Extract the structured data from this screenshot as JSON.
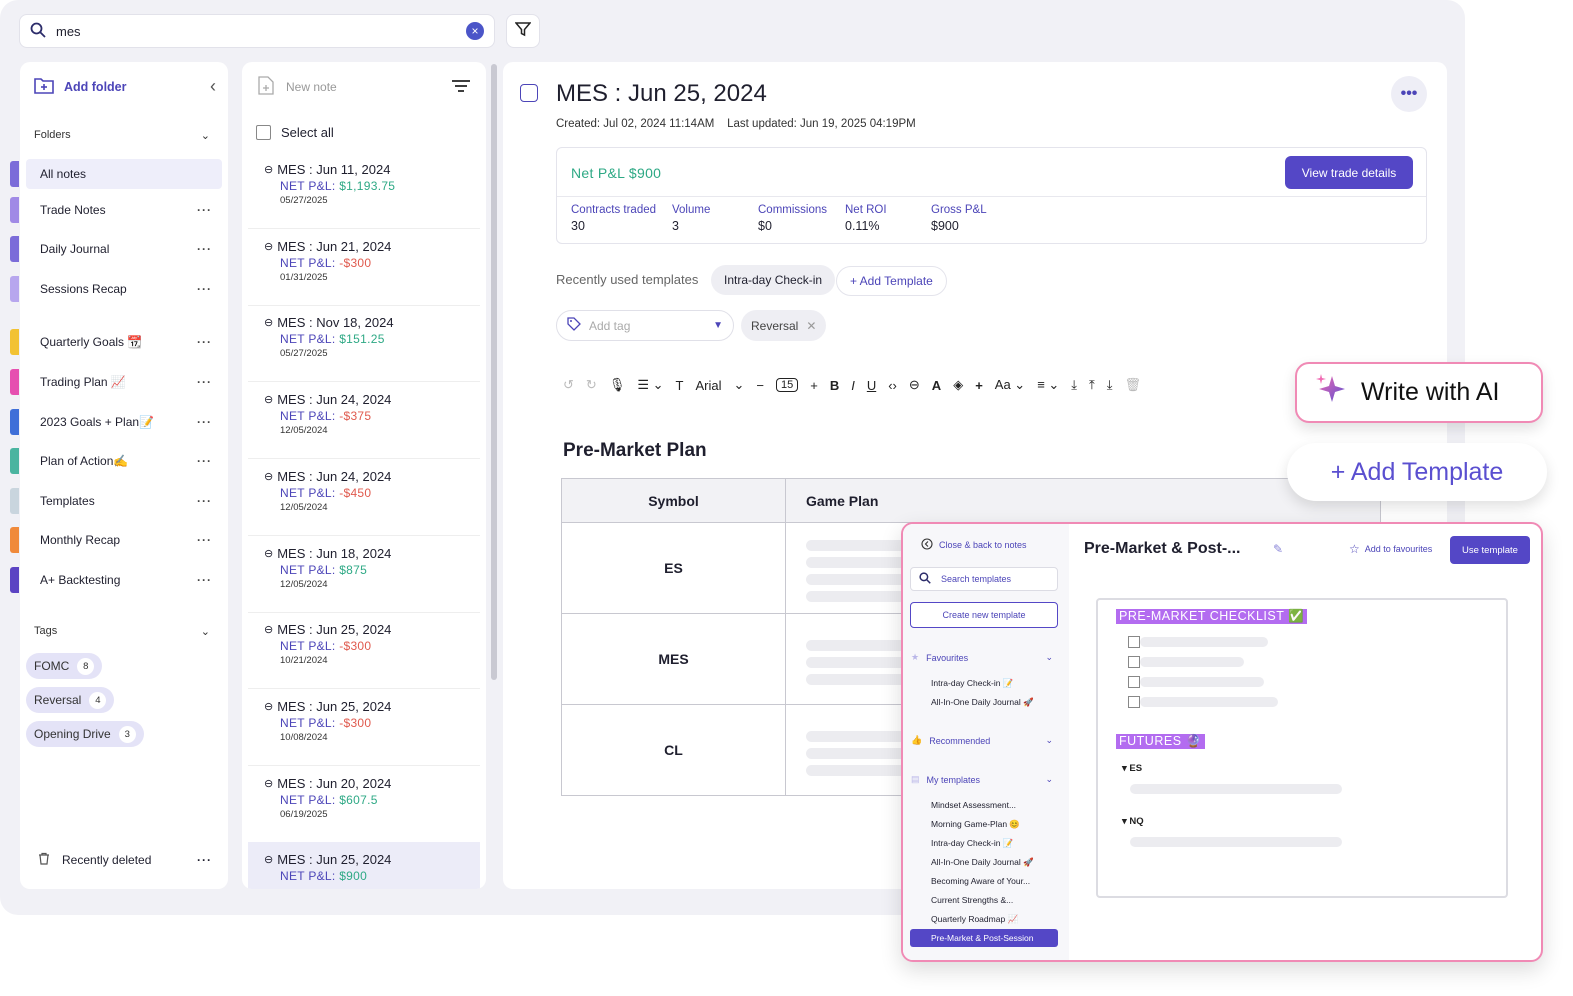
{
  "search": {
    "value": "mes"
  },
  "sidebar": {
    "add_folder": "Add folder",
    "folders_heading": "Folders",
    "folders": [
      {
        "label": "All notes"
      },
      {
        "label": "Trade Notes"
      },
      {
        "label": "Daily Journal"
      },
      {
        "label": "Sessions Recap"
      },
      {
        "label": "Quarterly Goals 📆"
      },
      {
        "label": "Trading Plan 📈"
      },
      {
        "label": "2023 Goals + Plan📝"
      },
      {
        "label": "Plan of Action✍️"
      },
      {
        "label": "Templates"
      },
      {
        "label": "Monthly Recap"
      },
      {
        "label": "A+ Backtesting"
      }
    ],
    "folder_colors": [
      "#7b6cd9",
      "#a08ae6",
      "#7b6cd9",
      "#b7a6ee",
      "#f2c233",
      "#e64fb0",
      "#3f6fd8",
      "#4ab4a0",
      "#c9d5de",
      "#f08a3b",
      "#5b43c3"
    ],
    "tags_heading": "Tags",
    "tags": [
      {
        "label": "FOMC",
        "count": "8"
      },
      {
        "label": "Reversal",
        "count": "4"
      },
      {
        "label": "Opening Drive",
        "count": "3"
      }
    ],
    "recently_deleted": "Recently deleted"
  },
  "notelist": {
    "new_note": "New note",
    "select_all": "Select all",
    "pnl_prefix": "NET P&L:",
    "notes": [
      {
        "title": "MES : Jun 11, 2024",
        "pnl": "$1,193.75",
        "date": "05/27/2025",
        "sign": "pos"
      },
      {
        "title": "MES : Jun 21, 2024",
        "pnl": "-$300",
        "date": "01/31/2025",
        "sign": "neg"
      },
      {
        "title": "MES : Nov 18, 2024",
        "pnl": "$151.25",
        "date": "05/27/2025",
        "sign": "pos"
      },
      {
        "title": "MES : Jun 24, 2024",
        "pnl": "-$375",
        "date": "12/05/2024",
        "sign": "neg"
      },
      {
        "title": "MES : Jun 24, 2024",
        "pnl": "-$450",
        "date": "12/05/2024",
        "sign": "neg"
      },
      {
        "title": "MES : Jun 18, 2024",
        "pnl": "$875",
        "date": "12/05/2024",
        "sign": "pos"
      },
      {
        "title": "MES : Jun 25, 2024",
        "pnl": "-$300",
        "date": "10/21/2024",
        "sign": "neg"
      },
      {
        "title": "MES : Jun 25, 2024",
        "pnl": "-$300",
        "date": "10/08/2024",
        "sign": "neg"
      },
      {
        "title": "MES : Jun 20, 2024",
        "pnl": "$607.5",
        "date": "06/19/2025",
        "sign": "pos"
      },
      {
        "title": "MES : Jun 25, 2024",
        "pnl": "$900",
        "date": "",
        "sign": "pos"
      }
    ]
  },
  "main": {
    "title": "MES : Jun 25, 2024",
    "meta": "Created: Jul 02, 2024 11:14AM    Last updated: Jun 19, 2025 04:19PM",
    "net_pl": "Net P&L $900",
    "view_trade_details": "View trade details",
    "stats": [
      {
        "label": "Contracts traded",
        "value": "30"
      },
      {
        "label": "Volume",
        "value": "3"
      },
      {
        "label": "Commissions",
        "value": "$0"
      },
      {
        "label": "Net ROI",
        "value": "0.11%"
      },
      {
        "label": "Gross P&L",
        "value": "$900"
      }
    ],
    "recent_templates_label": "Recently used templates",
    "recent_template": "Intra-day Check-in",
    "add_template_pill": "+ Add Template",
    "add_tag_placeholder": "Add tag",
    "tag_chip": "Reversal",
    "toolbar": {
      "font": "Arial",
      "size": "15"
    },
    "heading": "Pre-Market Plan",
    "table": {
      "headers": [
        "Symbol",
        "Game Plan"
      ],
      "rows": [
        "ES",
        "MES",
        "CL"
      ]
    }
  },
  "floating": {
    "write_ai": "Write with AI",
    "add_template": "+ Add Template"
  },
  "modal": {
    "close": "Close & back to notes",
    "search_placeholder": "Search templates",
    "create": "Create new template",
    "favourites": "Favourites",
    "fav_items": [
      "Intra-day Check-in 📝",
      "All-In-One Daily Journal 🚀"
    ],
    "recommended": "Recommended",
    "my_templates": "My templates",
    "my_items": [
      "Mindset Assessment...",
      "Morning Game-Plan 😊",
      "Intra-day Check-in 📝",
      "All-In-One Daily Journal 🚀",
      "Becoming Aware of Your...",
      "Current Strengths &...",
      "Quarterly Roadmap 📈"
    ],
    "selected": "Pre-Market & Post-Session",
    "title": "Pre-Market & Post-...",
    "add_fav": "Add to favourites",
    "use": "Use template",
    "checklist_heading": "PRE-MARKET CHECKLIST ✅",
    "futures_heading": "FUTURES 🔮",
    "futures_items": [
      "ES",
      "NQ"
    ]
  },
  "colors": {
    "accent": "#5447c6",
    "positive": "#2ea985",
    "negative": "#e05a4e",
    "highlight": "#b36cf0",
    "ai_border": "#f08ab5"
  }
}
